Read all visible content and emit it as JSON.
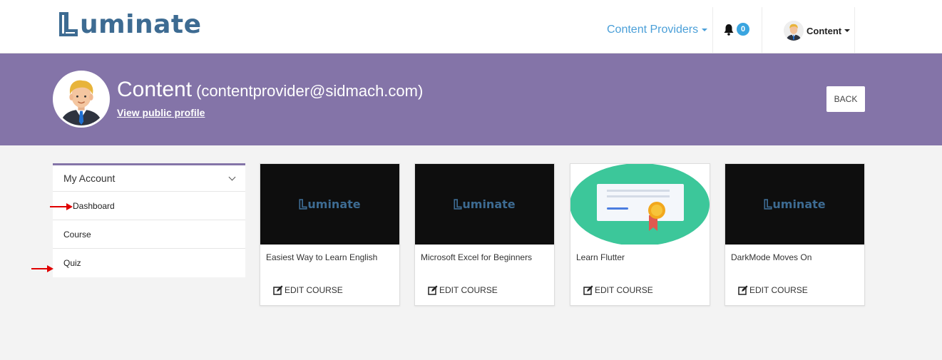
{
  "header": {
    "logo_text": "uminate",
    "nav_providers_label": "Content Providers",
    "notification_count": "0",
    "user_menu_label": "Content"
  },
  "profile": {
    "name": "Content",
    "email": "(contentprovider@sidmach.com)",
    "view_profile_label": "View public profile",
    "back_label": "BACK"
  },
  "sidebar": {
    "heading": "My Account",
    "items": [
      {
        "label": "Dashboard"
      },
      {
        "label": "Course"
      },
      {
        "label": "Quiz"
      }
    ]
  },
  "courses": [
    {
      "title": "Easiest Way to Learn English",
      "thumb": "luminate-logo",
      "edit_label": "EDIT COURSE"
    },
    {
      "title": "Microsoft Excel for Beginners",
      "thumb": "luminate-logo",
      "edit_label": "EDIT COURSE"
    },
    {
      "title": "Learn Flutter",
      "thumb": "certificate-illustration",
      "edit_label": "EDIT COURSE"
    },
    {
      "title": "DarkMode Moves On",
      "thumb": "luminate-logo",
      "edit_label": "EDIT COURSE"
    }
  ],
  "thumb_logo_text": "uminate",
  "colors": {
    "brand": "#3d6b92",
    "banner": "#8474a8",
    "link": "#4a9fd8",
    "badge": "#3aa5e0",
    "annotation_arrow": "#e00000"
  }
}
